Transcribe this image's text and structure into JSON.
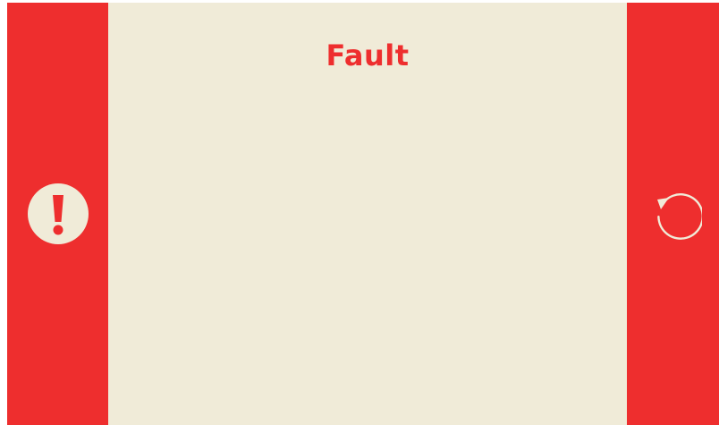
{
  "screen": {
    "title": "Fault"
  },
  "icons": {
    "left": "fault-exclamation-icon",
    "right": "reset-rotate-icon"
  },
  "colors": {
    "alert_red": "#ee2e2e",
    "cream": "#f0ebd8"
  }
}
